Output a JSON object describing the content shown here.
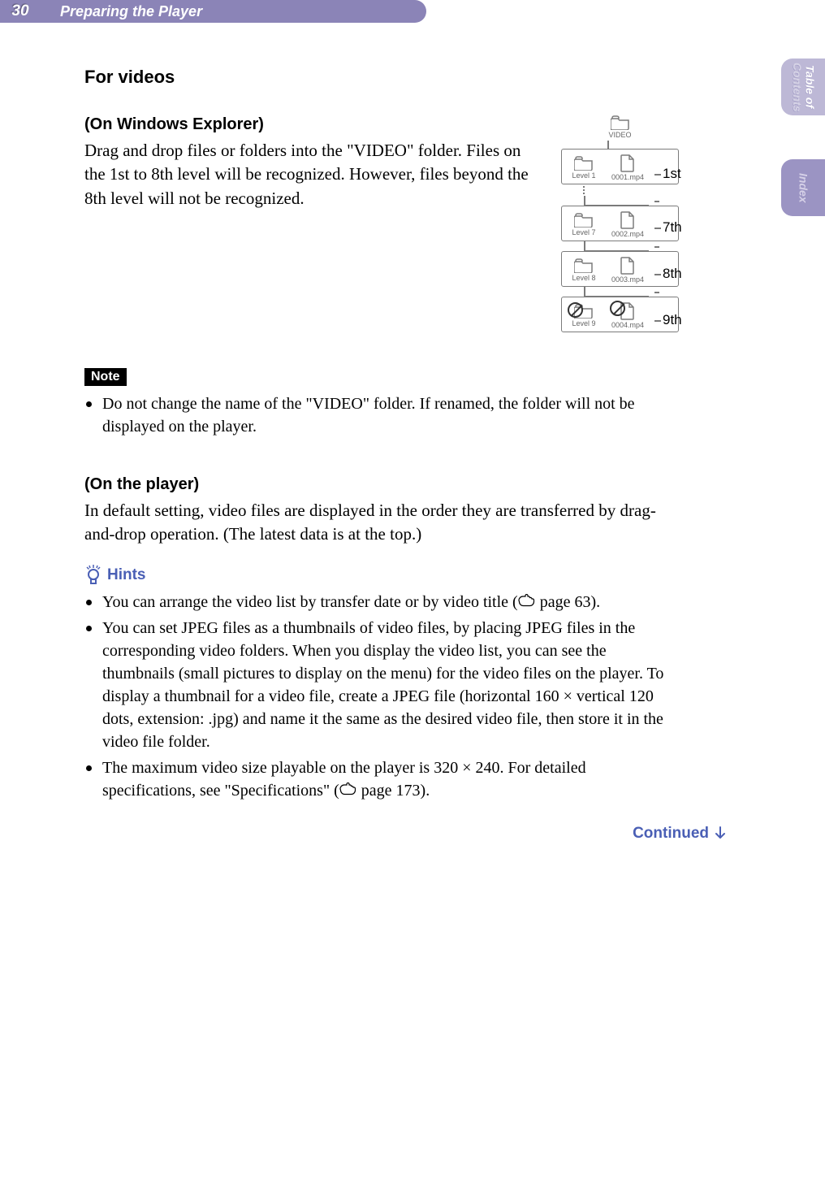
{
  "header": {
    "page_number": "30",
    "chapter": "Preparing the Player"
  },
  "sidebar": {
    "toc_line1": "Table of",
    "toc_line2": "Contents",
    "index": "Index"
  },
  "section": {
    "for_videos": "For videos",
    "explorer_heading": "(On Windows Explorer)",
    "explorer_body": "Drag and drop files or folders into the \"VIDEO\" folder. Files on the 1st to 8th level will be recognized. However, files beyond the 8th level will not be recognized."
  },
  "diagram": {
    "root_label": "VIDEO",
    "rows": [
      {
        "folder": "Level 1",
        "file": "0001.mp4",
        "side": "1st"
      },
      {
        "folder": "Level 7",
        "file": "0002.mp4",
        "side": "7th"
      },
      {
        "folder": "Level 8",
        "file": "0003.mp4",
        "side": "8th"
      },
      {
        "folder": "Level 9",
        "file": "0004.mp4",
        "side": "9th",
        "forbidden": true
      }
    ]
  },
  "note": {
    "label": "Note",
    "items": [
      "Do not change the name of the \"VIDEO\" folder. If renamed, the folder will not be displayed on the player."
    ]
  },
  "player": {
    "heading": "(On the player)",
    "body": "In default setting, video files are displayed in the order they are transferred by drag-and-drop operation. (The latest data is at the top.)"
  },
  "hints": {
    "label": "Hints",
    "items": [
      {
        "pre": "You can arrange the video list by transfer date or by video title (",
        "ref": " page 63).",
        "hand": true
      },
      {
        "pre": "You can set JPEG files as a thumbnails of video files, by placing JPEG files in the corresponding video folders. When you display the video list, you can see the thumbnails (small pictures to display on the menu) for the video files on the player. To display a thumbnail for a video file, create a JPEG file (horizontal 160 × vertical 120 dots, extension: .jpg) and name it the same as the desired video file, then store it in the video file folder.",
        "ref": "",
        "hand": false
      },
      {
        "pre": "The maximum video size playable on the player is 320 × 240. For detailed specifications, see \"Specifications\" (",
        "ref": " page 173).",
        "hand": true
      }
    ]
  },
  "continued": "Continued"
}
